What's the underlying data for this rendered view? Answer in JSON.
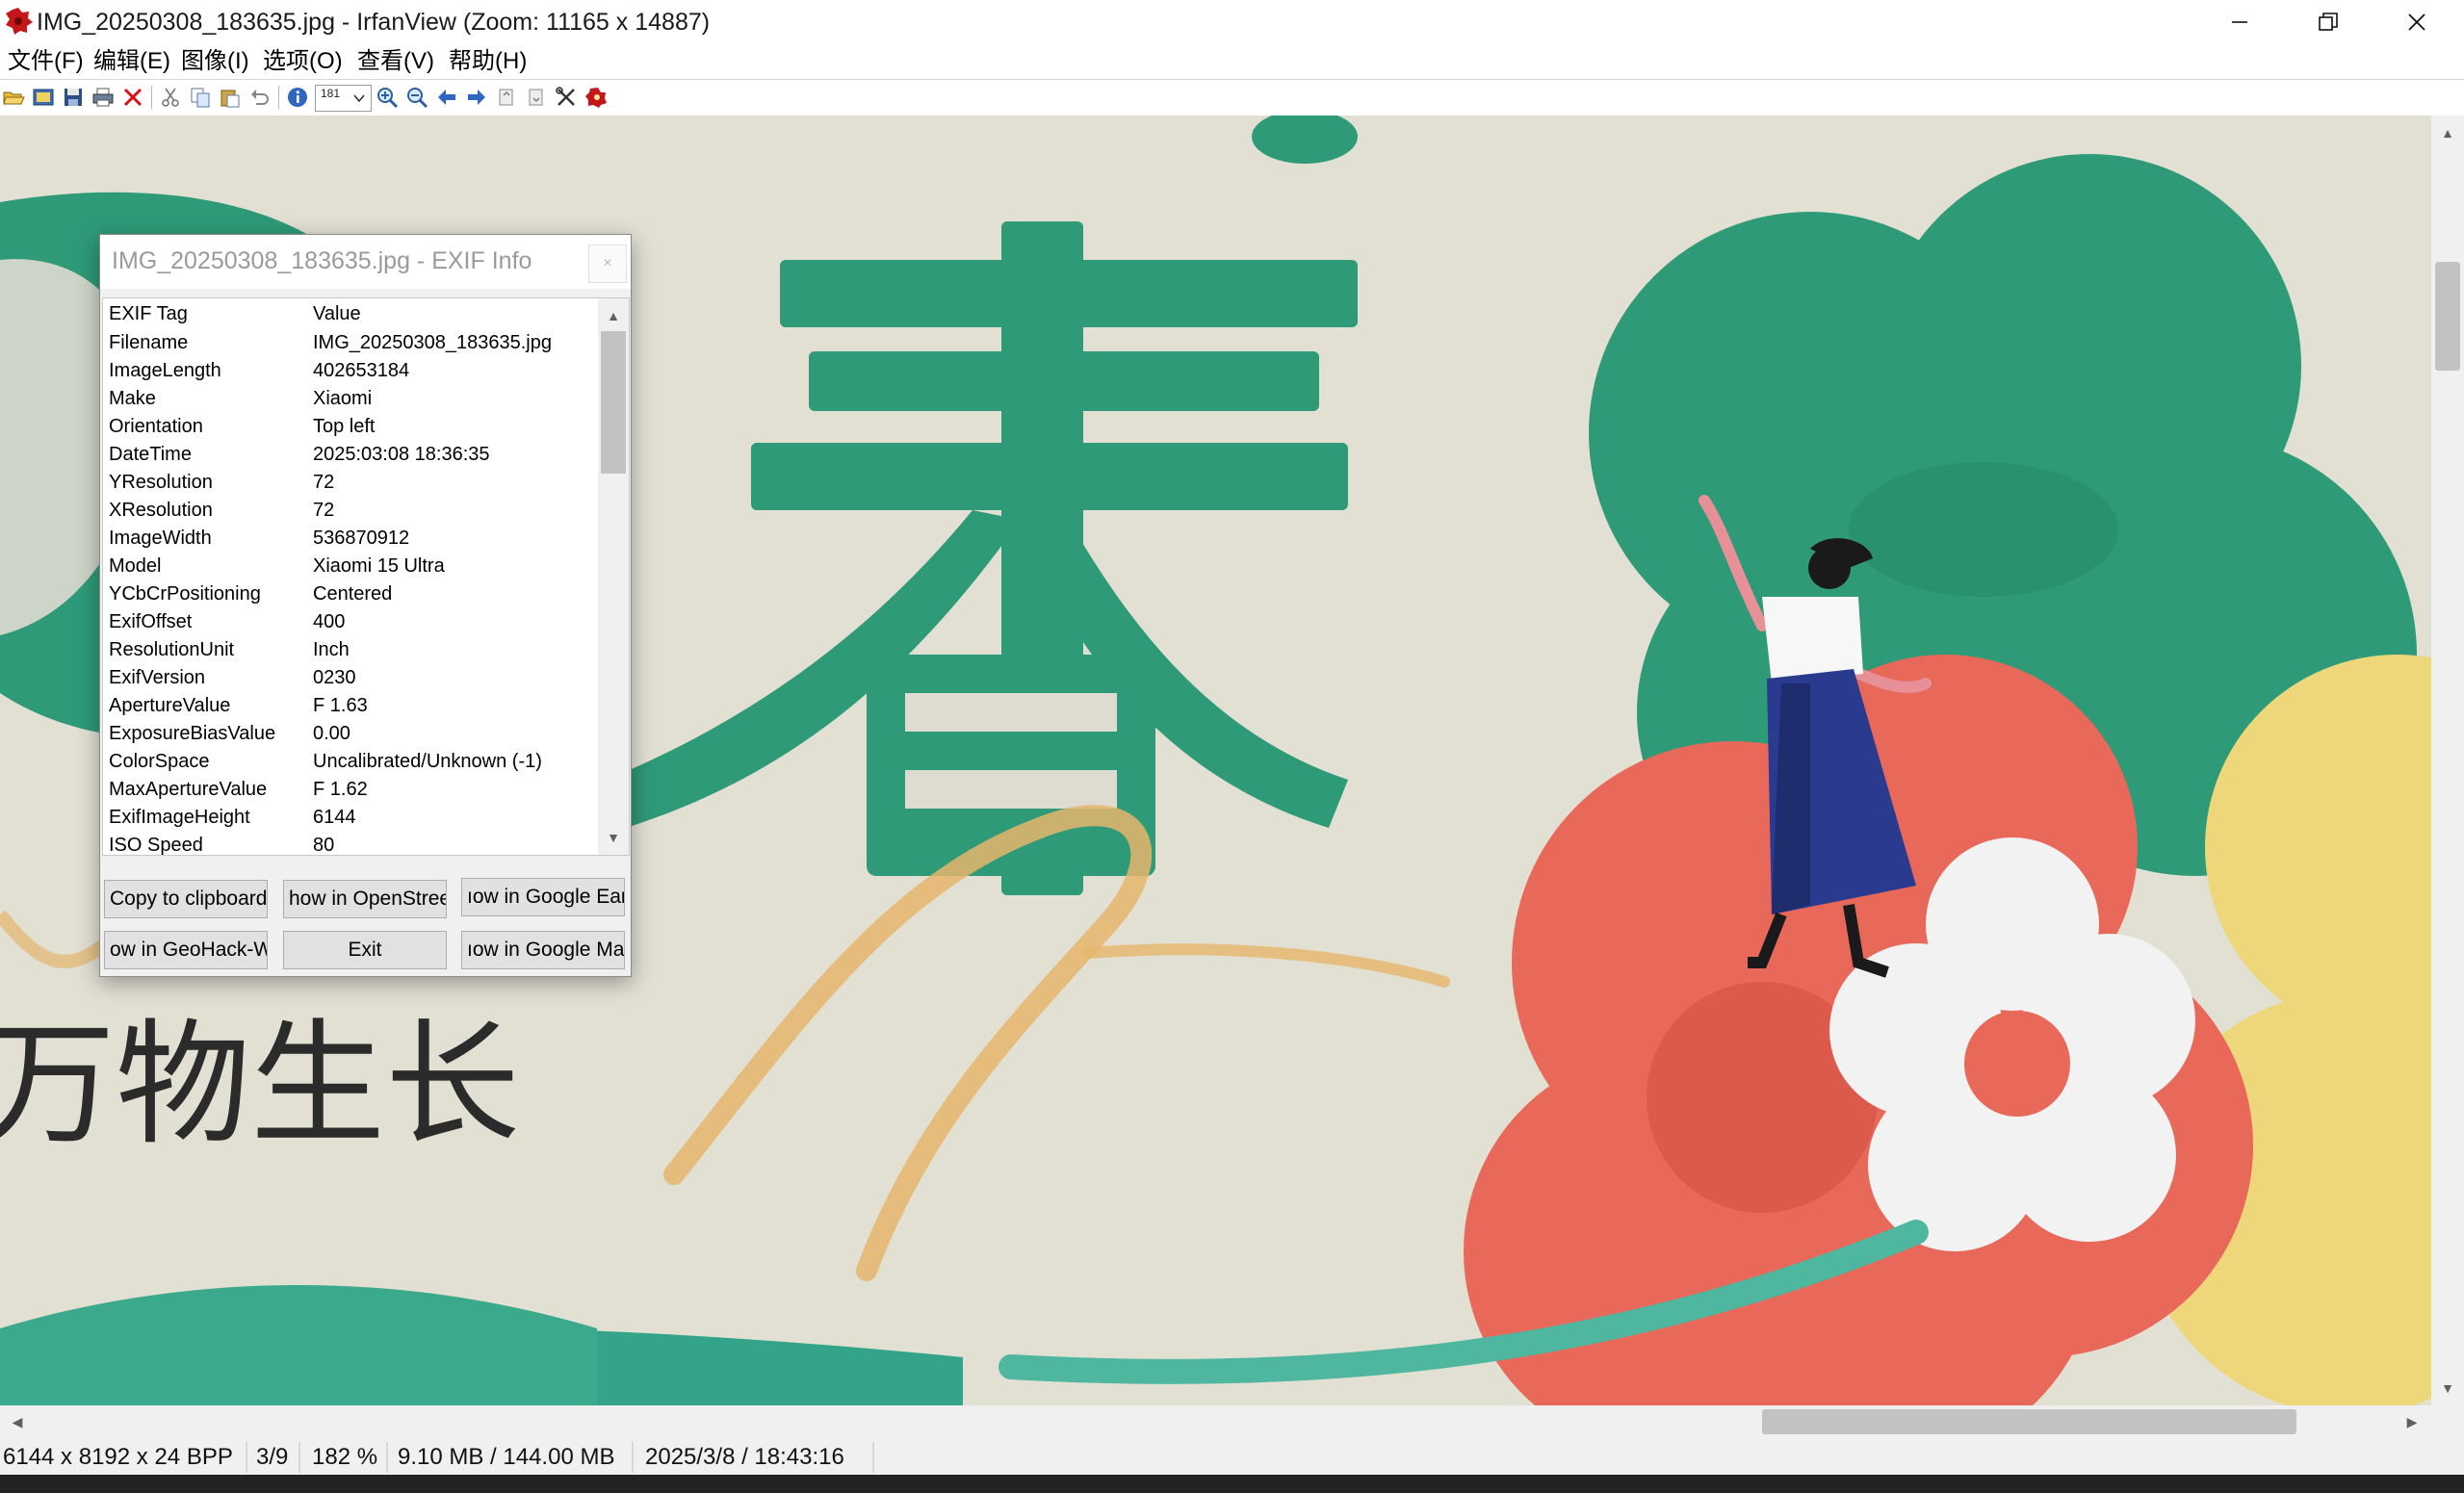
{
  "window": {
    "title": "IMG_20250308_183635.jpg - IrfanView (Zoom: 11165 x 14887)",
    "minimize_icon": "minimize-icon",
    "maximize_icon": "restore-icon",
    "close_icon": "close-icon"
  },
  "menu": {
    "items": [
      "文件(F)",
      "编辑(E)",
      "图像(I)",
      "选项(O)",
      "查看(V)",
      "帮助(H)"
    ]
  },
  "toolbar": {
    "zoom_value": "181",
    "icons": [
      "open-icon",
      "slideshow-icon",
      "save-icon",
      "print-icon",
      "delete-icon",
      "cut-icon",
      "copy-icon",
      "paste-icon",
      "undo-icon",
      "info-icon",
      "zoom-in-icon",
      "zoom-out-icon",
      "previous-icon",
      "next-icon",
      "first-page-icon",
      "last-page-icon",
      "settings-icon",
      "exit-icon"
    ]
  },
  "exif": {
    "title": "IMG_20250308_183635.jpg - EXIF Info",
    "close_glyph": "×",
    "header": {
      "tag": "EXIF Tag",
      "value": "Value"
    },
    "rows": [
      {
        "tag": "Filename",
        "value": "IMG_20250308_183635.jpg"
      },
      {
        "tag": "ImageLength",
        "value": "402653184"
      },
      {
        "tag": "Make",
        "value": "Xiaomi"
      },
      {
        "tag": "Orientation",
        "value": "Top left"
      },
      {
        "tag": "DateTime",
        "value": "2025:03:08 18:36:35"
      },
      {
        "tag": "YResolution",
        "value": "72"
      },
      {
        "tag": "XResolution",
        "value": "72"
      },
      {
        "tag": "ImageWidth",
        "value": "536870912"
      },
      {
        "tag": "Model",
        "value": "Xiaomi 15 Ultra"
      },
      {
        "tag": "YCbCrPositioning",
        "value": "Centered"
      },
      {
        "tag": "ExifOffset",
        "value": "400"
      },
      {
        "tag": "ResolutionUnit",
        "value": "Inch"
      },
      {
        "tag": "ExifVersion",
        "value": "0230"
      },
      {
        "tag": "ApertureValue",
        "value": "F 1.63"
      },
      {
        "tag": "ExposureBiasValue",
        "value": "0.00"
      },
      {
        "tag": "ColorSpace",
        "value": "Uncalibrated/Unknown (-1)"
      },
      {
        "tag": "MaxApertureValue",
        "value": "F 1.62"
      },
      {
        "tag": "ExifImageHeight",
        "value": "6144"
      },
      {
        "tag": "ISO Speed",
        "value": "80"
      }
    ],
    "buttons": {
      "copy": "Copy to clipboard",
      "openstreetmap": "how in OpenStree",
      "google_earth": "ıow in Google Ear",
      "geohack": "ow in GeoHack-W",
      "exit": "Exit",
      "google_maps": "ıow in Google Ma"
    }
  },
  "image": {
    "chinese_text": "万物生长",
    "big_char": "春"
  },
  "status": {
    "dimensions": "6144 x 8192 x 24 BPP",
    "index": "3/9",
    "zoom": "182 %",
    "size": "9.10 MB / 144.00 MB",
    "date": "2025/3/8 / 18:43:16"
  },
  "colors": {
    "teal": "#2e9a78",
    "coral": "#e8685a",
    "yellow": "#eed77a",
    "background": "#dcdcd0",
    "dialog_bg": "#f0f0f0"
  }
}
